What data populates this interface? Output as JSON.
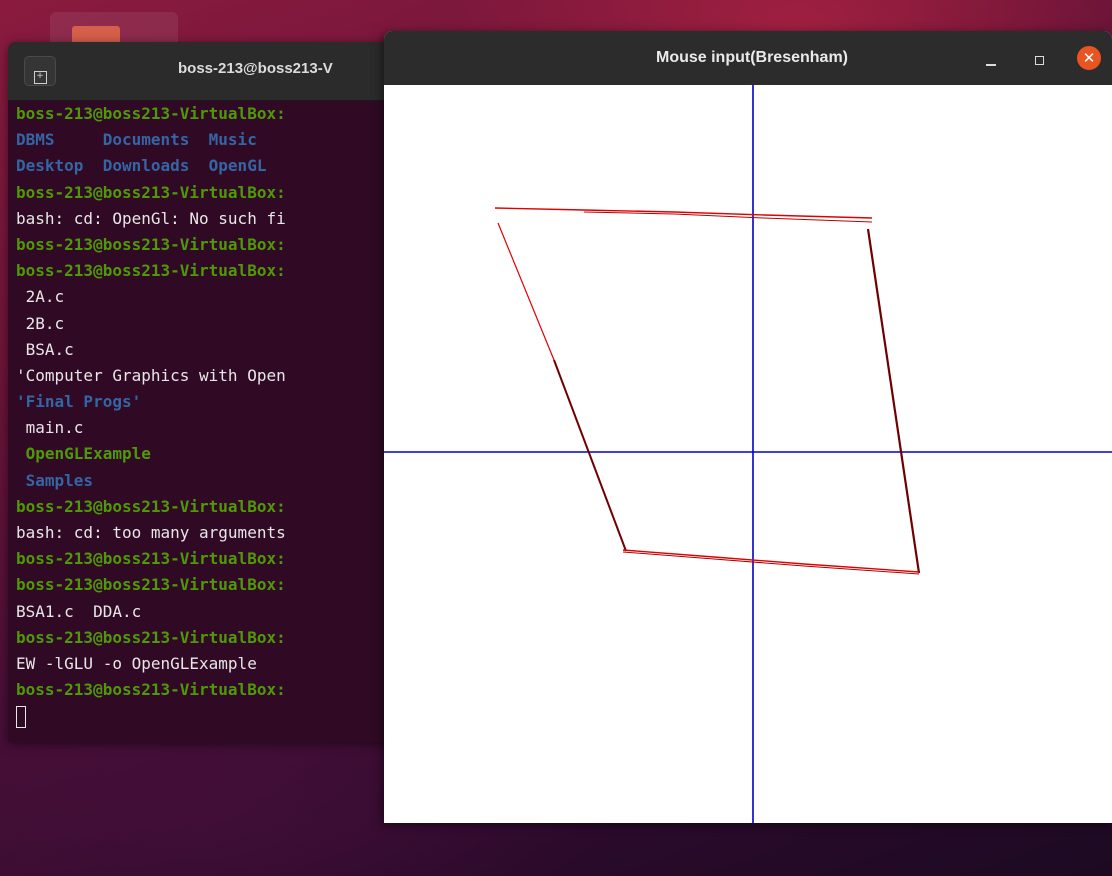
{
  "terminal": {
    "title": "boss-213@boss213-V",
    "new_tab_icon": "+",
    "lines": [
      [
        {
          "t": "boss-213@boss213-VirtualBox:",
          "c": "c-prompt"
        }
      ],
      [
        {
          "t": "DBMS     Documents  Music",
          "c": "c-dir"
        }
      ],
      [
        {
          "t": "Desktop  Downloads  OpenGL",
          "c": "c-dir"
        }
      ],
      [
        {
          "t": "boss-213@boss213-VirtualBox:",
          "c": "c-prompt"
        }
      ],
      [
        {
          "t": "bash: cd: OpenGl: No such fi",
          "c": "c-plain"
        }
      ],
      [
        {
          "t": "boss-213@boss213-VirtualBox:",
          "c": "c-prompt"
        }
      ],
      [
        {
          "t": "boss-213@boss213-VirtualBox:",
          "c": "c-prompt"
        }
      ],
      [
        {
          "t": " 2A.c",
          "c": "c-plain"
        }
      ],
      [
        {
          "t": " 2B.c",
          "c": "c-plain"
        }
      ],
      [
        {
          "t": " BSA.c",
          "c": "c-plain"
        }
      ],
      [
        {
          "t": "'Computer Graphics with Open",
          "c": "c-plain"
        }
      ],
      [
        {
          "t": "'Final Progs'",
          "c": "c-dir"
        }
      ],
      [
        {
          "t": " main.c",
          "c": "c-plain"
        }
      ],
      [
        {
          "t": " OpenGLExample",
          "c": "c-exec"
        }
      ],
      [
        {
          "t": " Samples",
          "c": "c-dir"
        }
      ],
      [
        {
          "t": "boss-213@boss213-VirtualBox:",
          "c": "c-prompt"
        }
      ],
      [
        {
          "t": "bash: cd: too many arguments",
          "c": "c-plain"
        }
      ],
      [
        {
          "t": "boss-213@boss213-VirtualBox:",
          "c": "c-prompt"
        }
      ],
      [
        {
          "t": "boss-213@boss213-VirtualBox:",
          "c": "c-prompt"
        }
      ],
      [
        {
          "t": "BSA1.c  DDA.c",
          "c": "c-plain"
        }
      ],
      [
        {
          "t": "boss-213@boss213-VirtualBox:",
          "c": "c-prompt"
        }
      ],
      [
        {
          "t": "EW -lGLU -o OpenGLExample",
          "c": "c-plain"
        }
      ],
      [
        {
          "t": "boss-213@boss213-VirtualBox:",
          "c": "c-prompt"
        }
      ]
    ]
  },
  "glwindow": {
    "title": "Mouse input(Bresenham)",
    "minimize_icon": "minimize-icon",
    "maximize_icon": "maximize-icon",
    "close_label": "✕",
    "colors": {
      "axis": "#0000c8",
      "shape": "#e00000",
      "shape_dark": "#700000",
      "background": "#ffffff"
    }
  }
}
